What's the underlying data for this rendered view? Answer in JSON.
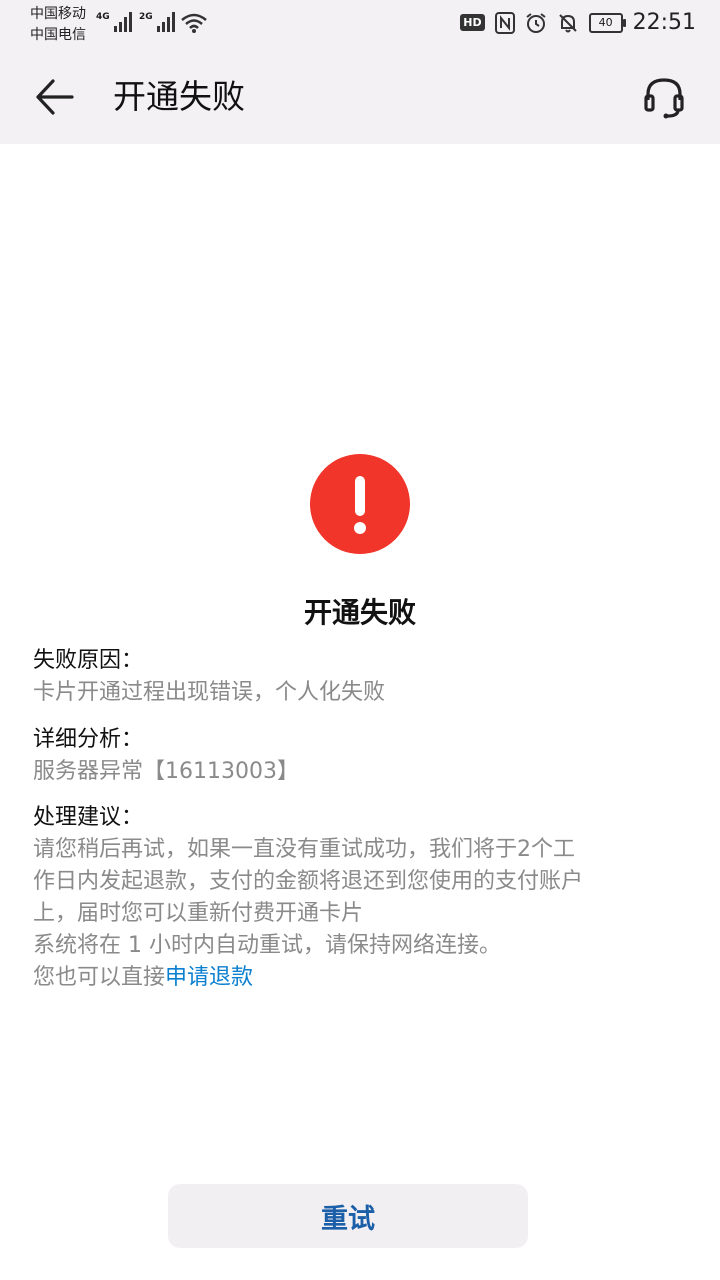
{
  "status_bar": {
    "carrier_1": "中国移动",
    "carrier_2": "中国电信",
    "sim1_network": "4G",
    "sim2_network": "2G",
    "hd_badge": "HD",
    "battery": "40",
    "time": "22:51",
    "icons": [
      "signal-icon",
      "wifi-icon",
      "nfc-icon",
      "alarm-icon",
      "mute-icon",
      "battery-icon"
    ]
  },
  "header": {
    "title": "开通失败",
    "back_icon": "back-arrow-icon",
    "service_icon": "headset-icon"
  },
  "result": {
    "status_icon": "error-exclamation-icon",
    "status_color": "#f2352a",
    "title": "开通失败"
  },
  "details": {
    "reason_label": "失败原因：",
    "reason_text": "卡片开通过程出现错误，个人化失败",
    "analysis_label": "详细分析：",
    "analysis_text": "服务器异常【16113003】",
    "advice_label": "处理建议：",
    "advice_lines": [
      "请您稍后再试，如果一直没有重试成功，我们将于2个工",
      "作日内发起退款，支付的金额将退还到您使用的支付账户",
      "上，届时您可以重新付费开通卡片",
      "系统将在 1 小时内自动重试，请保持网络连接。"
    ],
    "refund_prefix": "您也可以直接",
    "refund_link": "申请退款"
  },
  "actions": {
    "retry_label": "重试"
  }
}
